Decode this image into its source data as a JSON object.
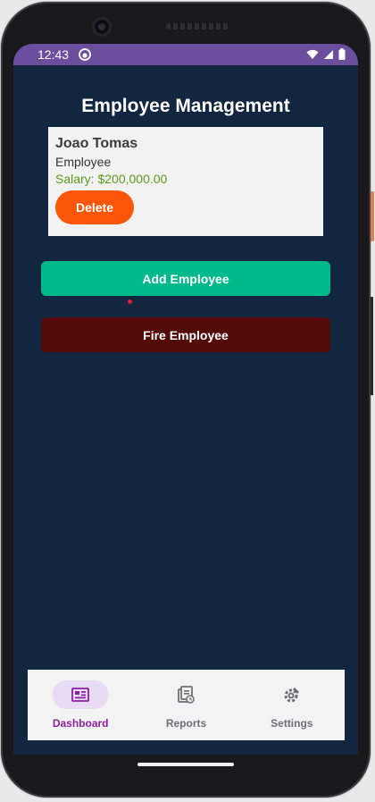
{
  "status_bar": {
    "time": "12:43",
    "app_icon": "android-app-icon",
    "icons": [
      "wifi-icon",
      "signal-icon",
      "battery-icon"
    ]
  },
  "page": {
    "title": "Employee Management"
  },
  "employee_card": {
    "name": "Joao Tomas",
    "role": "Employee",
    "salary": "Salary: $200,000.00",
    "delete_label": "Delete"
  },
  "actions": {
    "add_label": "Add Employee",
    "fire_label": "Fire Employee"
  },
  "bottom_nav": {
    "items": [
      {
        "label": "Dashboard",
        "icon": "dashboard-icon",
        "active": true
      },
      {
        "label": "Reports",
        "icon": "reports-icon",
        "active": false
      },
      {
        "label": "Settings",
        "icon": "settings-icon",
        "active": false
      }
    ]
  },
  "colors": {
    "screen_background": "#132640",
    "status_bar": "#6b4f9e",
    "delete_button": "#fb5607",
    "add_button": "#00b98b",
    "fire_button": "#550a0a",
    "salary_text": "#5c9a1e",
    "nav_active": "#8e1ea4",
    "nav_active_pill": "#e7dcf3"
  }
}
